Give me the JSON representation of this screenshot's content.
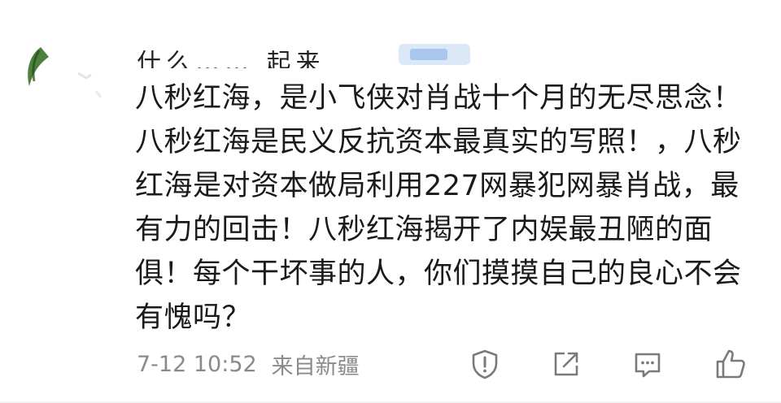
{
  "comment": {
    "username_fragment": "什么…… 起来",
    "text": "八秒红海，是小飞侠对肖战十个月的无尽思念！八秒红海是民义反抗资本最真实的写照！，八秒红海是对资本做局利用227网暴犯网暴肖战，最有力的回击！八秒红海揭开了内娱最丑陋的面俱！每个干坏事的人，你们摸摸自己的良心不会有愧吗？",
    "time": "7-12 10:52",
    "location": "来自新疆"
  },
  "actions": {
    "report_icon": "report-icon",
    "share_icon": "share-icon",
    "reply_icon": "comment-icon",
    "like_icon": "thumbs-up-icon"
  },
  "colors": {
    "text": "#1a1a1a",
    "meta": "#8a8a8a",
    "icon": "#7a7a7a",
    "badge": "#dbe8f8"
  }
}
